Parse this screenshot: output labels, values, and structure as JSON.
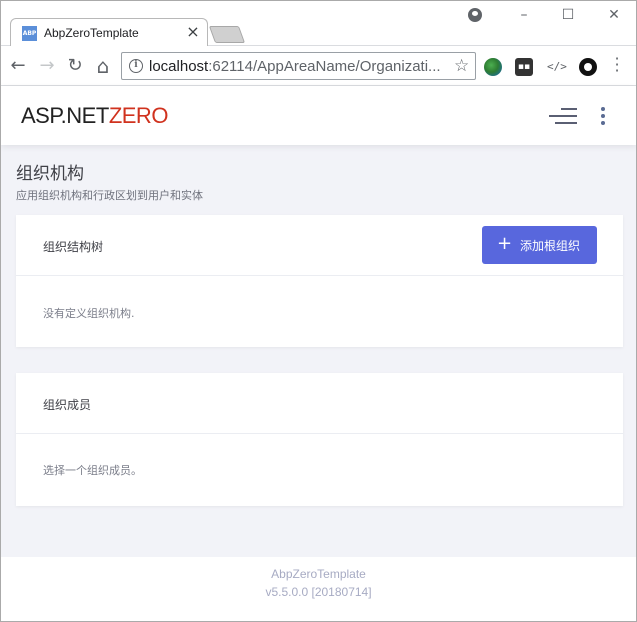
{
  "browser": {
    "tab_title": "AbpZeroTemplate",
    "tab_favicon_text": "ABP",
    "tab_close": "×",
    "url_host": "localhost",
    "url_rest": ":62114/AppAreaName/Organizati...",
    "window_minimize": "–",
    "window_maximize": "☐",
    "window_close": "✕",
    "back": "←",
    "forward": "→",
    "reload": "↻",
    "home": "⌂",
    "star": "☆",
    "ext_devtools": "</>",
    "info": "i"
  },
  "header": {
    "logo_part1": "ASP.NET",
    "logo_part2": "ZERO"
  },
  "page": {
    "title": "组织机构",
    "subtitle": "应用组织机构和行政区划到用户和实体"
  },
  "tree_card": {
    "title": "组织结构树",
    "add_button_icon": "+",
    "add_button_label": "添加根组织",
    "empty_text": "没有定义组织机构."
  },
  "members_card": {
    "title": "组织成员",
    "empty_text": "选择一个组织成员。"
  },
  "footer": {
    "app_name": "AbpZeroTemplate",
    "version": "v5.5.0.0 [20180714]"
  },
  "colors": {
    "brand_red": "#d0321e",
    "primary_button": "#5867dd",
    "content_bg": "#f2f3f8"
  }
}
